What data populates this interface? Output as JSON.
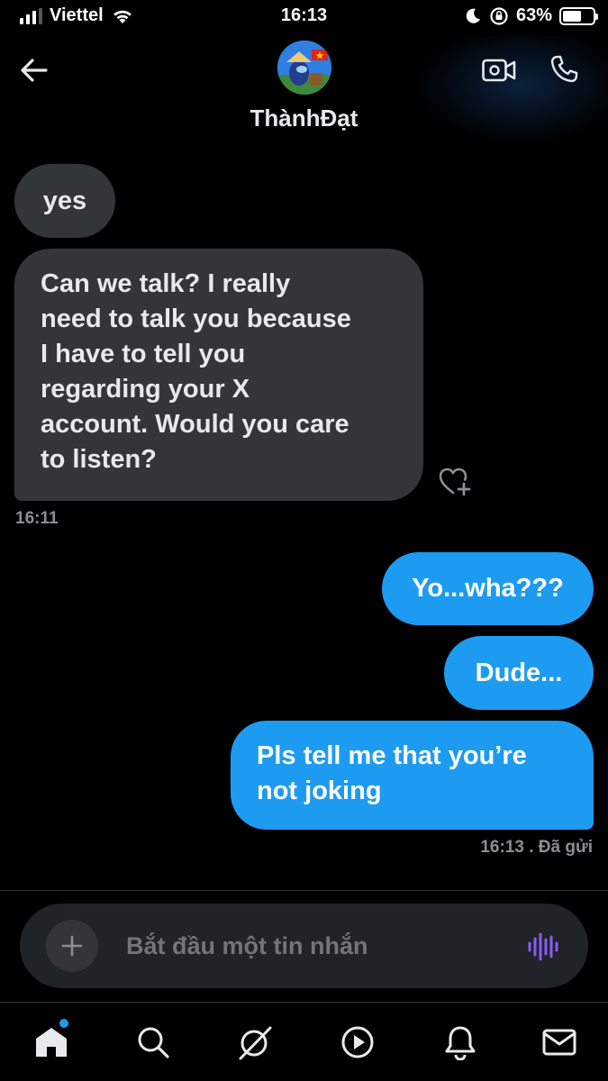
{
  "status_bar": {
    "carrier": "Viettel",
    "time": "16:13",
    "battery_percent": "63%",
    "battery_level": 0.63,
    "icons": [
      "signal-icon",
      "wifi-icon",
      "moon-icon",
      "rotation-lock-icon",
      "battery-icon"
    ]
  },
  "header": {
    "contact_name": "ThànhĐạt",
    "icons": [
      "back-arrow-icon",
      "video-call-icon",
      "phone-icon"
    ]
  },
  "messages": [
    {
      "direction": "received",
      "text": "yes"
    },
    {
      "direction": "received",
      "text": "Can we talk? I really\nneed to talk you because\nI have to tell you\nregarding  your X\naccount. Would you care\nto listen?"
    },
    {
      "direction": "sent",
      "text": "Yo...wha???"
    },
    {
      "direction": "sent",
      "text": "Dude..."
    },
    {
      "direction": "sent",
      "text": "Pls tell me that you’re\nnot joking"
    }
  ],
  "timestamps": {
    "received": "16:11",
    "sent": "16:13  . Đã gửi"
  },
  "composer": {
    "placeholder": "Bắt đầu một tin nhắn",
    "icons": [
      "plus-icon",
      "voice-icon"
    ]
  },
  "bottom_nav": {
    "items": [
      "home-icon",
      "search-icon",
      "grok-icon",
      "video-icon",
      "notifications-icon",
      "messages-icon"
    ]
  },
  "colors": {
    "background": "#000000",
    "received_bubble": "#333639",
    "sent_bubble": "#1d9bf0",
    "timestamp": "#8b8f93",
    "voice_icon": "#8b5cf6"
  }
}
